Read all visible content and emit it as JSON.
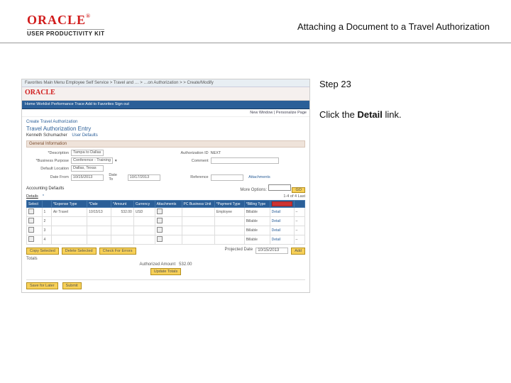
{
  "header": {
    "logo_text": "ORACLE",
    "logo_reg": "®",
    "upk": "USER PRODUCTIVITY KIT",
    "title": "Attaching a Document to a Travel Authorization"
  },
  "instruction": {
    "step": "Step 23",
    "prefix": "Click the ",
    "link": "Detail",
    "suffix": " link."
  },
  "app": {
    "toolbar": "Favorites   Main Menu   Employee Self Service > Travel and … > …on Authorization >  > Create/Modify",
    "brand": "ORACLE",
    "nav": "Home   Worklist   Performance Trace   Add to Favorites   Sign out",
    "subnav": "New Window | Personalize Page",
    "crumb": "Create Travel Authorization",
    "h1": "Travel Authorization Entry",
    "who": "Kenneth Schumacher",
    "who_tab": "User Defaults",
    "sec_general": "General Information",
    "fields": {
      "desc_lbl": "*Description",
      "desc_val": "Tampa to Dallas",
      "auth_lbl": "Authorization ID",
      "auth_val": "NEXT",
      "biz_lbl": "*Business Purpose",
      "biz_val": "Conference - Training",
      "comm_lbl": "Comment",
      "comm_val": "",
      "loc_lbl": "Default Location",
      "loc_val": "Dallas, Texas",
      "from_lbl": "Date From",
      "from_val": "10/15/2013",
      "to_lbl": "Date To",
      "to_val": "10/17/2013",
      "ref_lbl": "Reference",
      "ref_val": "",
      "att_val": "Attachments"
    },
    "acct_hdr": "Accounting Defaults",
    "more_lbl": "More Options:",
    "go": "GO",
    "tabs": {
      "details": "Details",
      "sel": "*"
    },
    "cols": [
      "Select",
      "",
      "*Expense Type",
      "*Date",
      "*Amount",
      "Currency",
      "Attachments",
      "PC Business Unit",
      "*Payment Type",
      "*Billing Type",
      "",
      " "
    ],
    "pager": "1-4 of 4   Last",
    "rows": [
      {
        "n": "1",
        "exp": "Air Travel",
        "date": "10/15/13",
        "amt": "532.00",
        "cur": "USD",
        "pay": "Employee",
        "bill": "Billable"
      },
      {
        "n": "2",
        "exp": "",
        "date": "",
        "amt": "",
        "cur": "",
        "pay": "",
        "bill": "Billable"
      },
      {
        "n": "3",
        "exp": "",
        "date": "",
        "amt": "",
        "cur": "",
        "pay": "",
        "bill": "Billable"
      },
      {
        "n": "4",
        "exp": "",
        "date": "",
        "amt": "",
        "cur": "",
        "pay": "",
        "bill": "Billable"
      }
    ],
    "btns": {
      "copy": "Copy Selected",
      "del": "Delete Selected",
      "check": "Check For Errors"
    },
    "tot": "Totals",
    "auth_amt_lbl": "Authorized Amount",
    "auth_amt": "532.00",
    "upd": "Update Totals",
    "foot": {
      "save": "Save for Later",
      "submit": "Submit"
    },
    "proj_date_lbl": "Projected Date",
    "proj_date": "10/15/2013",
    "addbtn": "Add"
  }
}
